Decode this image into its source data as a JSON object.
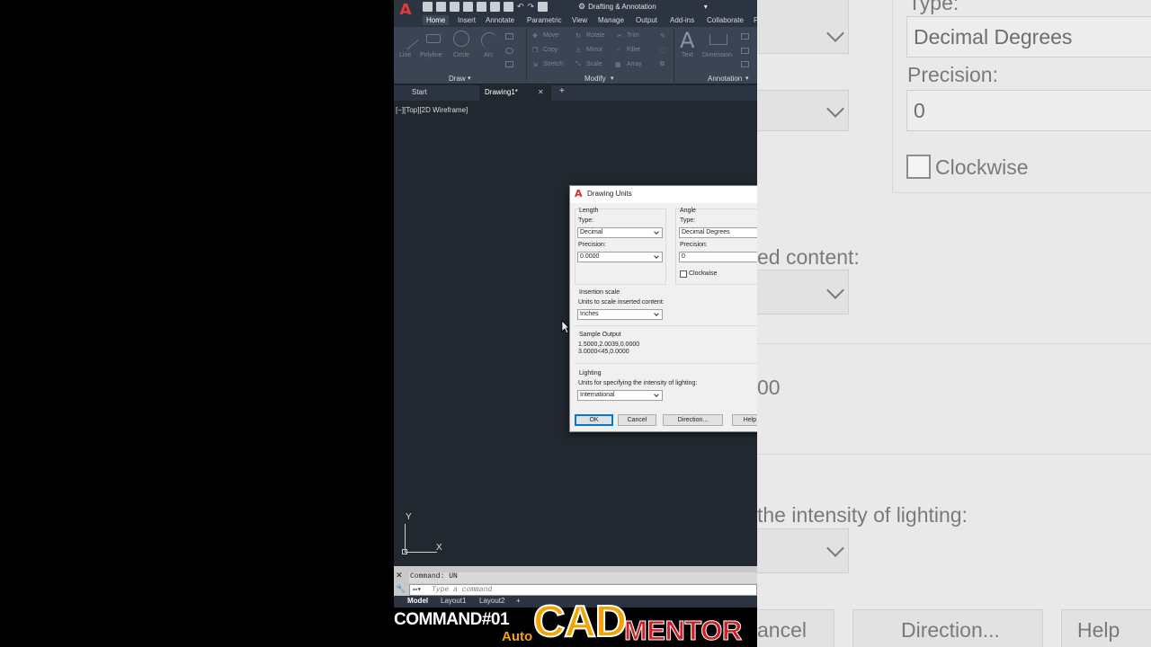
{
  "qat": {
    "logo": "A",
    "workspace": "Drafting & Annotation"
  },
  "ribbon_tabs": [
    "Home",
    "Insert",
    "Annotate",
    "Parametric",
    "View",
    "Manage",
    "Output",
    "Add-ins",
    "Collaborate",
    "F"
  ],
  "ribbon": {
    "draw_tools": [
      "Line",
      "Polyline",
      "Circle",
      "Arc"
    ],
    "modify_tools": [
      "Move",
      "Rotate",
      "Trim",
      "Copy",
      "Mirror",
      "Fillet",
      "Stretch",
      "Scale",
      "Array"
    ],
    "annotation_tools": [
      "Text",
      "Dimension"
    ],
    "panels": [
      "Draw",
      "Modify",
      "Annotation"
    ]
  },
  "doc_tabs": {
    "start": "Start",
    "active": "Drawing1*",
    "close": "✕",
    "add": "+"
  },
  "viewport_label": "[−][Top][2D Wireframe]",
  "ucs": {
    "y": "Y",
    "x": "X"
  },
  "command": {
    "history": "Command: UN",
    "placeholder": "Type a command"
  },
  "layout_tabs": [
    "Model",
    "Layout1",
    "Layout2",
    "+"
  ],
  "dialog": {
    "title": "Drawing Units",
    "length": {
      "heading": "Length",
      "type_label": "Type:",
      "type_value": "Decimal",
      "precision_label": "Precision:",
      "precision_value": "0.0000"
    },
    "angle": {
      "heading": "Angle",
      "type_label": "Type:",
      "type_value": "Decimal Degrees",
      "precision_label": "Precision:",
      "precision_value": "0",
      "clockwise_label": "Clockwise"
    },
    "insertion": {
      "heading": "Insertion scale",
      "label": "Units to scale inserted content:",
      "value": "Inches"
    },
    "sample": {
      "heading": "Sample Output",
      "line1": "1.5000,2.0039,0.0000",
      "line2": "3.0000<45,0.0000"
    },
    "lighting": {
      "heading": "Lighting",
      "label": "Units for specifying the intensity of lighting:",
      "value": "International"
    },
    "buttons": {
      "ok": "OK",
      "cancel": "Cancel",
      "direction": "Direction...",
      "help": "Help"
    }
  },
  "zoom": {
    "type_label": "Type:",
    "type_value": "Decimal Degrees",
    "precision_label": "Precision:",
    "precision_value": "0",
    "clockwise_label": "Clockwise",
    "inserted": "ed content:",
    "sample_frag": "00",
    "lighting_frag": "the intensity of lighting:",
    "cancel_frag": "ancel",
    "direction": "Direction...",
    "help": "Help"
  },
  "branding": {
    "command": "COMMAND#01",
    "auto": "Auto",
    "cad": "CAD",
    "mentor": "MENTOR"
  },
  "colors": {
    "cad_bg": "#212830",
    "ribbon_bg": "#3b4452",
    "brand_orange": "#f4a400",
    "brand_red": "#d11f1f",
    "ok_focus": "#0078d7"
  }
}
